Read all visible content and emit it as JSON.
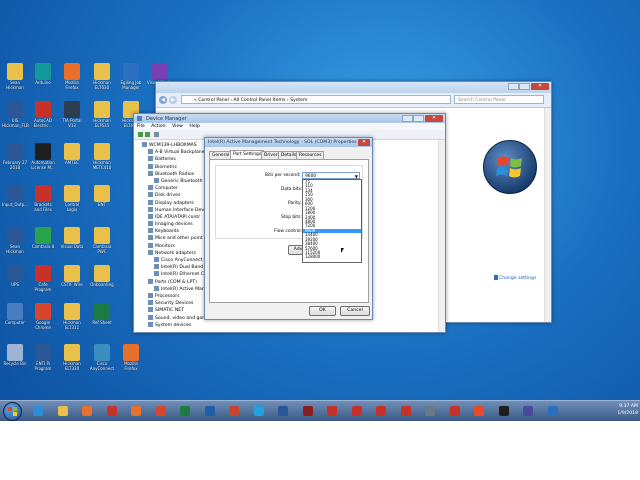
{
  "desktop_icons": [
    {
      "label": "Sean Hickman",
      "color": "#e8c04a"
    },
    {
      "label": "Arduino",
      "color": "#12999c"
    },
    {
      "label": "Mozilla Firefox",
      "color": "#e8702a"
    },
    {
      "label": "Hickman ELT630",
      "color": "#e8c04a"
    },
    {
      "label": "Egiling Job Manager",
      "color": "#2a6fc0"
    },
    {
      "label": "Visual Studio",
      "color": "#7b3fb5"
    },
    {
      "label": "UIS Hickman_FLB",
      "color": "#2b5797"
    },
    {
      "label": "AutoCAD Electric...",
      "color": "#c8302a"
    },
    {
      "label": "TIA Portal V13",
      "color": "#2c3e50"
    },
    {
      "label": "Hickman ELT635",
      "color": "#e8c04a"
    },
    {
      "label": "Hickman ELT645",
      "color": "#e8c04a"
    },
    {
      "label": "February 27 2018",
      "color": "#2b5797"
    },
    {
      "label": "Automation License M...",
      "color": "#1e1e1e"
    },
    {
      "label": "AMTEC",
      "color": "#e8c04a"
    },
    {
      "label": "Hickman METC410",
      "color": "#e8c04a"
    },
    {
      "label": "Input_Outp...",
      "color": "#2b5797"
    },
    {
      "label": "Brackets and Files",
      "color": "#c8302a"
    },
    {
      "label": "Control Logix",
      "color": "#e8c04a"
    },
    {
      "label": "ENT",
      "color": "#e8c04a"
    },
    {
      "label": "Sean Hickman",
      "color": "#2b5797"
    },
    {
      "label": "Camtasia 8",
      "color": "#2aa34a"
    },
    {
      "label": "Visual Data",
      "color": "#e8c04a"
    },
    {
      "label": "Camtasia PWC",
      "color": "#e8c04a"
    },
    {
      "label": "UPS",
      "color": "#2b5797"
    },
    {
      "label": "Cafe Program",
      "color": "#c8302a"
    },
    {
      "label": "CSTIF Wire",
      "color": "#e8c04a"
    },
    {
      "label": "Onboarding",
      "color": "#e8c04a"
    },
    {
      "label": "Computer",
      "color": "#4a7dbd"
    },
    {
      "label": "Google Chrome",
      "color": "#d8452f"
    },
    {
      "label": "Hickman ELT311",
      "color": "#e8c04a"
    },
    {
      "label": "Ref Sheet",
      "color": "#1e7a45"
    },
    {
      "label": "Recycle Bin",
      "color": "#9db4d4"
    },
    {
      "label": "ENTI Pi Program",
      "color": "#2b5797"
    },
    {
      "label": "Hickman ELT330",
      "color": "#e8c04a"
    },
    {
      "label": "Cisco AnyConnect",
      "color": "#3a8fc0"
    },
    {
      "label": "Mozilla Firefox",
      "color": "#e8702a"
    }
  ],
  "control_panel": {
    "address": "« Control Panel › All Control Panel Items › System",
    "search_placeholder": "Search Control Panel",
    "change_settings": "Change settings"
  },
  "device_manager": {
    "title": "Device Manager",
    "menu": [
      "File",
      "Action",
      "View",
      "Help"
    ],
    "tree": [
      "WCM139-LHBOXMAS",
      "A-B Virtual Backplane",
      "Batteries",
      "Biometric",
      "Bluetooth Radios",
      "Generic Bluetooth",
      "Computer",
      "Disk drives",
      "Display adapters",
      "Human Interface Dev",
      "IDE ATA/ATAPI contr",
      "Imaging devices",
      "Keyboards",
      "Mice and other point",
      "Monitors",
      "Network adapters",
      "Cisco AnyConnect",
      "Intel(R) Dual Band",
      "Intel(R) Ethernet C",
      "Ports (COM & LPT)",
      "Intel(R) Active Man",
      "Processors",
      "Security Devices",
      "SIMATIC NET",
      "Sound, video and game controllers",
      "System devices"
    ]
  },
  "properties_dialog": {
    "title": "Intel(R) Active Management Technology - SOL (COM3) Properties",
    "tabs": [
      "General",
      "Port Settings",
      "Driver",
      "Details",
      "Resources"
    ],
    "fields": {
      "bps_label": "Bits per second:",
      "bps_value": "9600",
      "data_bits_label": "Data bits:",
      "parity_label": "Parity:",
      "stop_bits_label": "Stop bits:",
      "flow_label": "Flow control:",
      "advanced_label": "Adv"
    },
    "bps_options": [
      "75",
      "110",
      "134",
      "150",
      "300",
      "600",
      "1200",
      "1800",
      "2400",
      "4800",
      "7200",
      "9600",
      "14400",
      "19200",
      "38400",
      "57600",
      "115200",
      "128000"
    ],
    "selected_option": "9600",
    "ok": "OK",
    "cancel": "Cancel"
  },
  "taskbar": {
    "time": "9:37 AM",
    "date": "1/9/2018",
    "apps": [
      {
        "name": "ie",
        "color": "#2a8fd8"
      },
      {
        "name": "explorer",
        "color": "#e8c04a"
      },
      {
        "name": "media",
        "color": "#e8702a"
      },
      {
        "name": "red-app",
        "color": "#c8302a"
      },
      {
        "name": "firefox",
        "color": "#e8702a"
      },
      {
        "name": "chrome",
        "color": "#d8452f"
      },
      {
        "name": "excel",
        "color": "#1e7a45"
      },
      {
        "name": "outlook",
        "color": "#1f5fa8"
      },
      {
        "name": "powerpoint",
        "color": "#c8452f"
      },
      {
        "name": "skype",
        "color": "#1fa0e0"
      },
      {
        "name": "word",
        "color": "#2b5797"
      },
      {
        "name": "adobe",
        "color": "#8c1d1d"
      },
      {
        "name": "autocad",
        "color": "#c8302a"
      },
      {
        "name": "autocad2",
        "color": "#c8302a"
      },
      {
        "name": "autocad3",
        "color": "#c8302a"
      },
      {
        "name": "autocad4",
        "color": "#c8302a"
      },
      {
        "name": "tool",
        "color": "#6a7a8a"
      },
      {
        "name": "app",
        "color": "#c8302a"
      },
      {
        "name": "camtasia",
        "color": "#e84a2a"
      },
      {
        "name": "app2",
        "color": "#1e1e1e"
      },
      {
        "name": "app3",
        "color": "#4a4a9a"
      },
      {
        "name": "app4",
        "color": "#2a6fc0"
      }
    ]
  }
}
